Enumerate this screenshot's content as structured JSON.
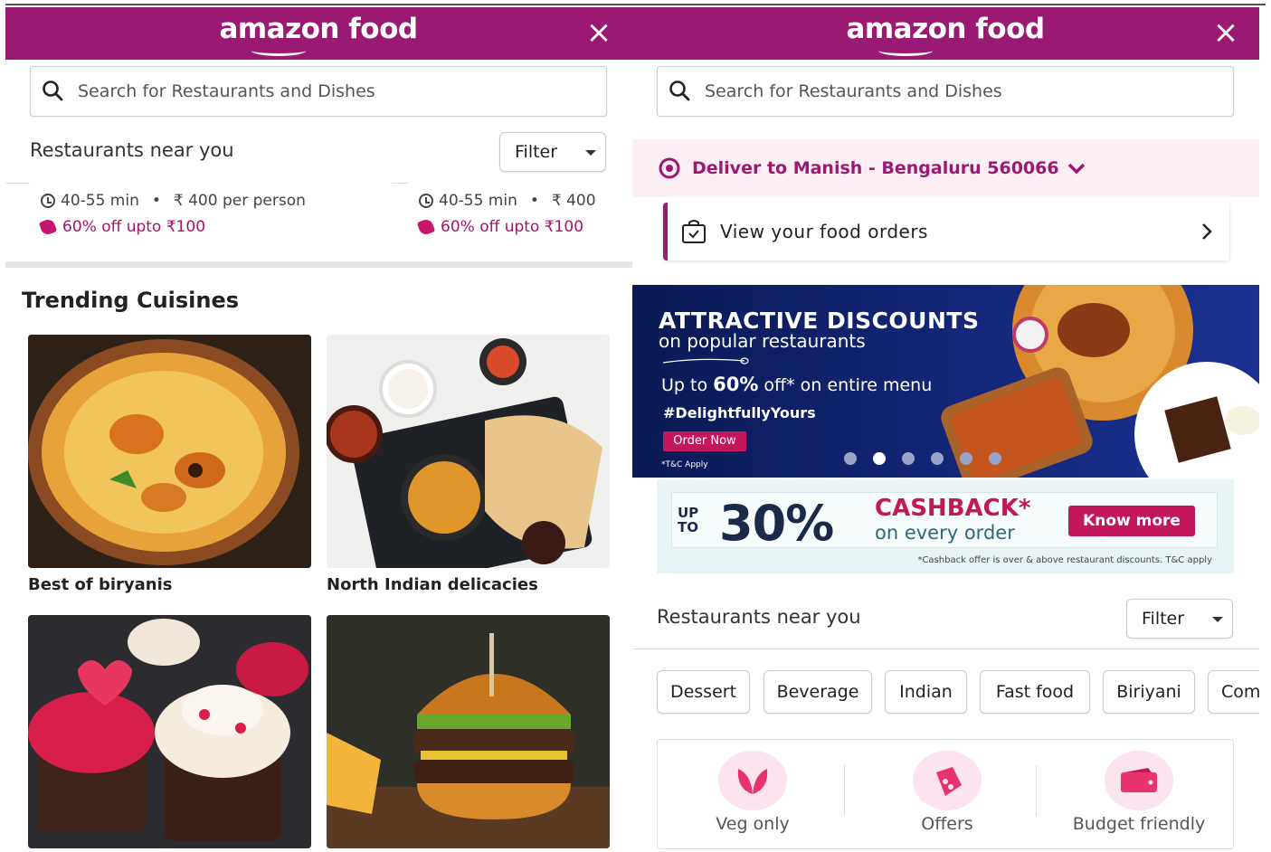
{
  "app": {
    "brand": "amazon food",
    "close_label": "×"
  },
  "left": {
    "search_placeholder": "Search for Restaurants and Dishes",
    "near_title": "Restaurants near you",
    "filter_label": "Filter",
    "cards": [
      {
        "time": "40-55 min",
        "price": "₹ 400 per person",
        "offer": "60% off upto ₹100"
      },
      {
        "time": "40-55 min",
        "price": "₹ 400",
        "offer": "60% off upto ₹100"
      }
    ],
    "trending_title": "Trending Cuisines",
    "cuisines": [
      {
        "label": "Best of biryanis"
      },
      {
        "label": "North Indian delicacies"
      },
      {
        "label": ""
      },
      {
        "label": ""
      }
    ]
  },
  "right": {
    "search_placeholder": "Search for Restaurants and Dishes",
    "deliver_to": "Deliver to Manish - Bengaluru 560066",
    "orders_label": "View your food orders",
    "banner": {
      "headline": "ATTRACTIVE DISCOUNTS",
      "subline": "on popular restaurants",
      "offer_prefix": "Up to ",
      "offer_value": "60%",
      "offer_suffix": " off* on entire menu",
      "hashtag": "#DelightfullyYours",
      "cta": "Order Now",
      "terms": "*T&C Apply"
    },
    "cashback": {
      "up": "UP",
      "to": "TO",
      "percent": "30%",
      "title": "CASHBACK*",
      "subtitle": "on every order",
      "button": "Know more",
      "note": "*Cashback offer is over & above restaurant discounts. T&C apply"
    },
    "near_title": "Restaurants near you",
    "filter_label": "Filter",
    "chips": [
      "Dessert",
      "Beverage",
      "Indian",
      "Fast food",
      "Biriyani",
      "Com"
    ],
    "quick_filters": [
      {
        "label": "Veg only",
        "icon": "leaf-icon"
      },
      {
        "label": "Offers",
        "icon": "offer-tag-icon"
      },
      {
        "label": "Budget friendly",
        "icon": "wallet-icon"
      }
    ]
  },
  "colors": {
    "brand": "#9a1a73",
    "offer": "#a1176b",
    "banner_bg": "#0a1a55",
    "cashback_btn": "#c2185b"
  }
}
